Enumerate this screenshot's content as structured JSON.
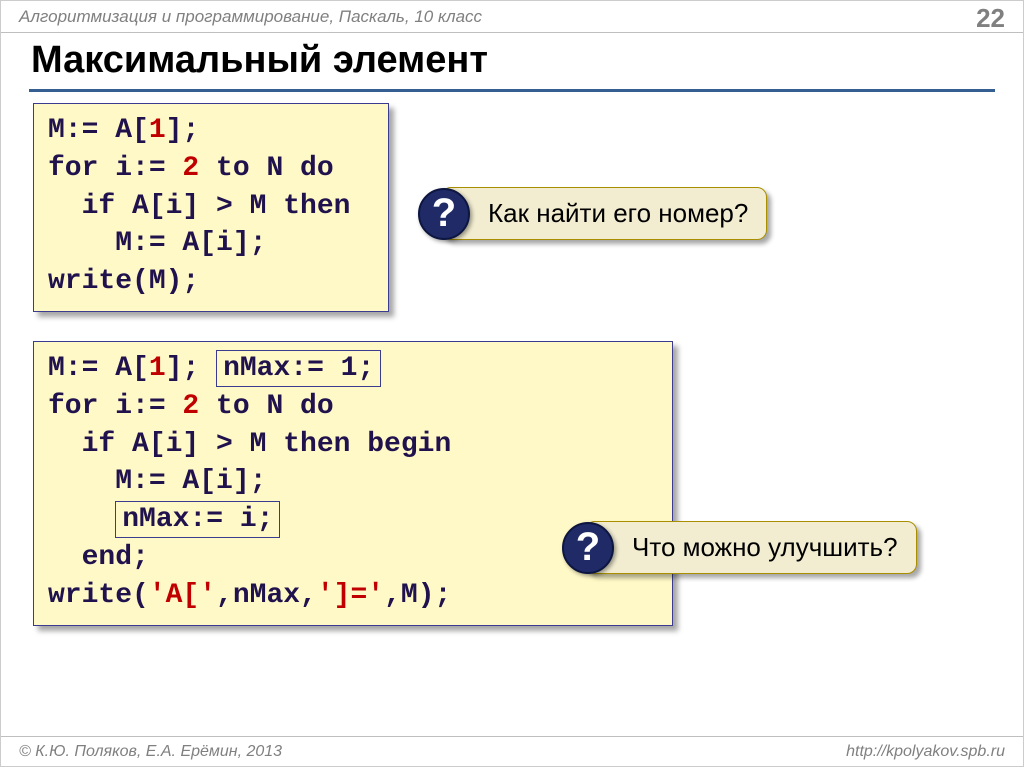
{
  "header": {
    "subject": "Алгоритмизация и программирование, Паскаль, 10 класс",
    "page": "22"
  },
  "title": "Максимальный элемент",
  "code1": {
    "l1a": "M:= A[",
    "l1b": "1",
    "l1c": "];",
    "l2a": "for i:= ",
    "l2b": "2",
    "l2c": " to N do",
    "l3": "  if A[i] > M then",
    "l4": "    M:= A[i];",
    "l5": "write(M);"
  },
  "callout1": "Как найти его номер?",
  "code2": {
    "l1a": "M:= A[",
    "l1b": "1",
    "l1c": "]; ",
    "l1hl": "nMax:= 1;",
    "l2a": "for i:= ",
    "l2b": "2",
    "l2c": " to N do",
    "l3": "  if A[i] > M then begin",
    "l4": "    M:= A[i];",
    "l5pre": "    ",
    "l5hl": "nMax:= i;",
    "l6": "  end;",
    "l7a": "write(",
    "l7s1": "'A['",
    "l7b": ",nMax,",
    "l7s2": "']='",
    "l7c": ",M);"
  },
  "callout2": "Что можно улучшить?",
  "footer": {
    "left": "© К.Ю. Поляков, Е.А. Ерёмин, 2013",
    "right": "http://kpolyakov.spb.ru"
  }
}
